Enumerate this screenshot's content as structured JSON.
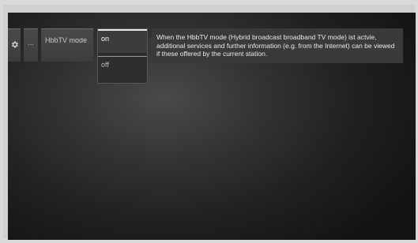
{
  "menu": {
    "ellipsis": "...",
    "item_label": "HbbTV mode",
    "options": [
      "on",
      "off"
    ],
    "selected": "on"
  },
  "info": {
    "text": "When the HbbTV mode (Hybrid broadcast broadband TV mode) ist actvie, additional services and further information (e.g. from the Internet) can be viewed if these offered by the current station."
  },
  "icons": {
    "settings": "gear-icon"
  },
  "colors": {
    "background": "#2a2a2a",
    "highlight": "#e8e8e8"
  }
}
